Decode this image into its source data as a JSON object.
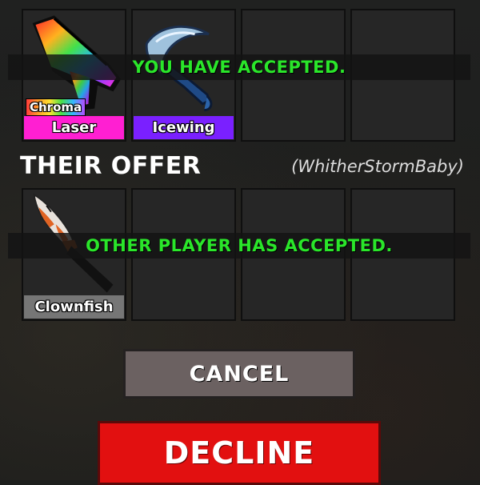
{
  "your_offer": {
    "slots": [
      {
        "item": "Laser",
        "badge": "Chroma",
        "rarity_color": "#ff1fd2",
        "icon": "chroma-laser-gun-icon"
      },
      {
        "item": "Icewing",
        "rarity_color": "#7a20ff",
        "icon": "icewing-knife-icon"
      },
      {
        "item": ""
      },
      {
        "item": ""
      }
    ],
    "status_banner": "YOU HAVE ACCEPTED."
  },
  "their_offer": {
    "title": "THEIR OFFER",
    "player_name": "(WhitherStormBaby)",
    "slots": [
      {
        "item": "Clownfish",
        "rarity_color": "#767676",
        "icon": "clownfish-knife-icon"
      },
      {
        "item": ""
      },
      {
        "item": ""
      },
      {
        "item": ""
      }
    ],
    "status_banner": "OTHER PLAYER HAS ACCEPTED."
  },
  "buttons": {
    "cancel": "CANCEL",
    "decline": "DECLINE"
  },
  "colors": {
    "accepted_text": "#2ae62a",
    "decline": "#e21010",
    "cancel": "#6b6161"
  }
}
